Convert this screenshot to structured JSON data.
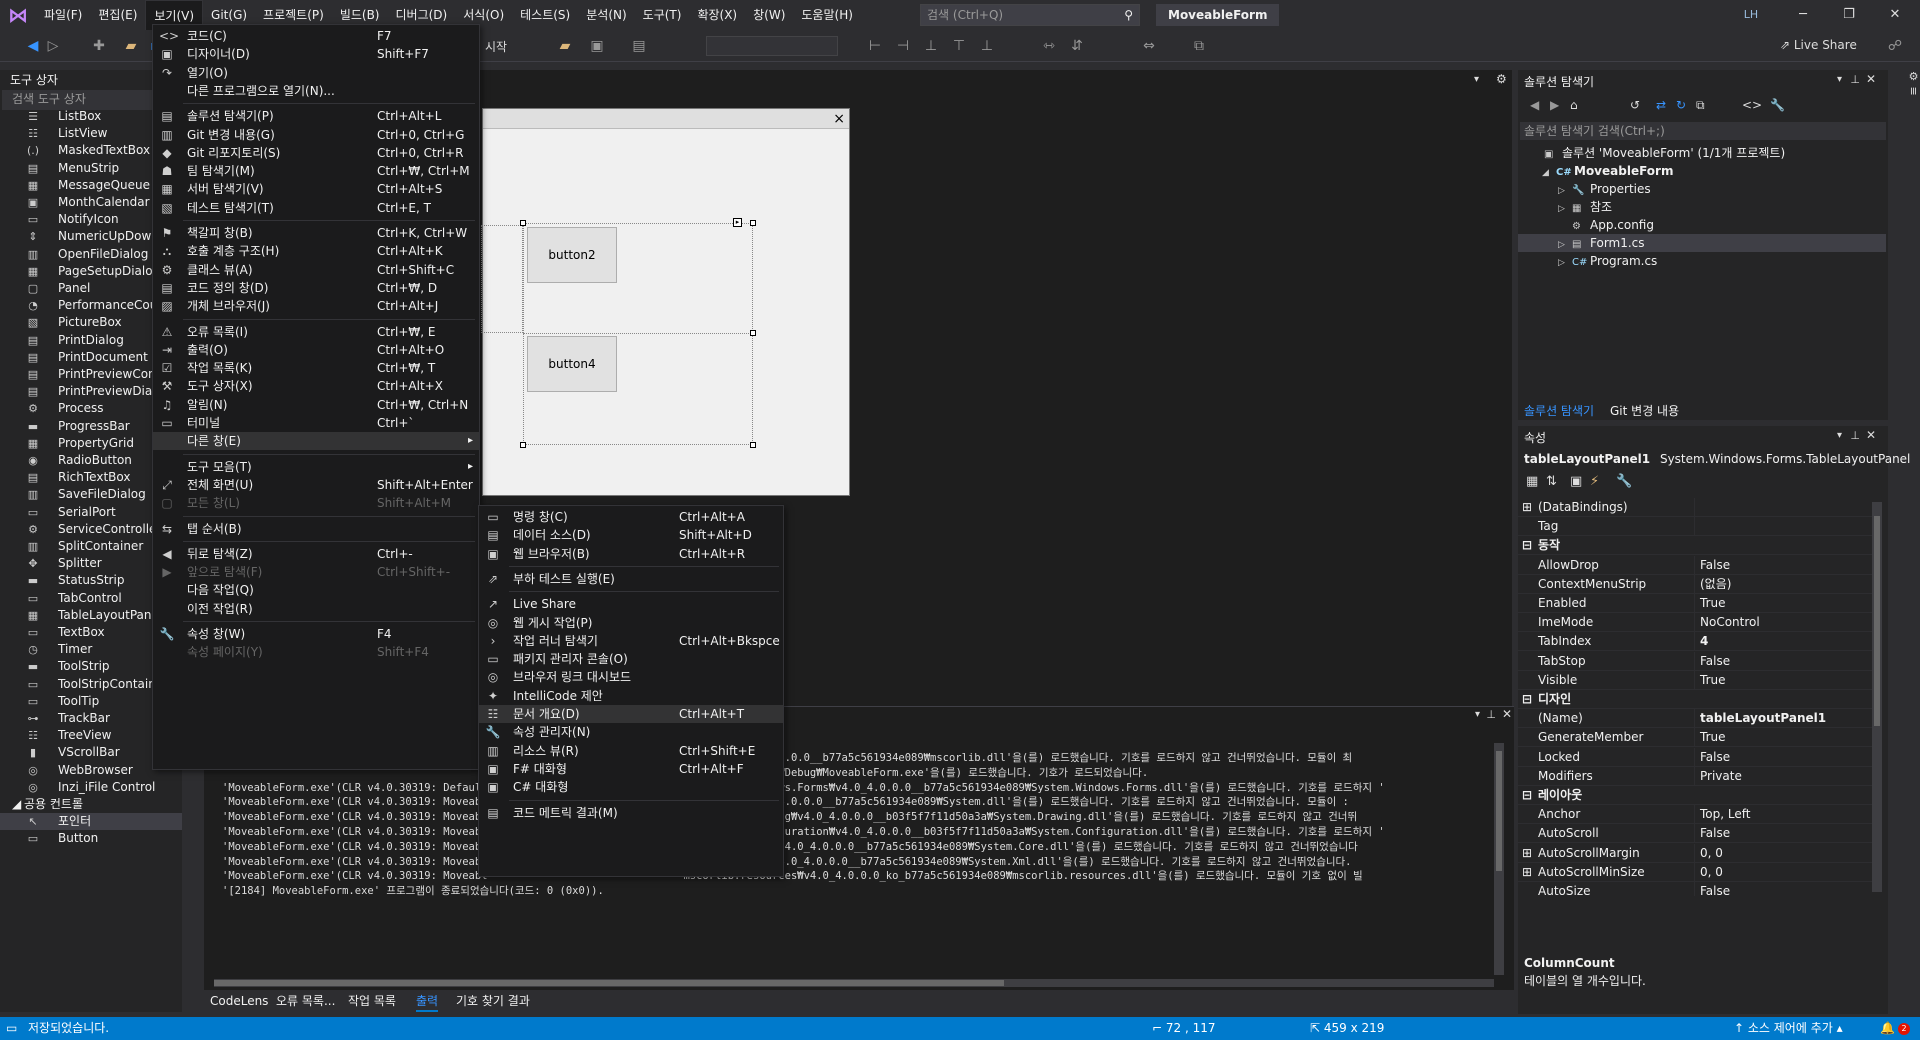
{
  "menubar": {
    "items": [
      "파일(F)",
      "편집(E)",
      "보기(V)",
      "Git(G)",
      "프로젝트(P)",
      "빌드(B)",
      "디버그(D)",
      "서식(O)",
      "테스트(S)",
      "분석(N)",
      "도구(T)",
      "확장(X)",
      "창(W)",
      "도움말(H)"
    ],
    "search_placeholder": "검색 (Ctrl+Q)",
    "app_title": "MoveableForm",
    "avatar": "LH"
  },
  "toolbar": {
    "start_label": "시작",
    "live_share": "Live Share"
  },
  "toolbox": {
    "title": "도구 상자",
    "search_placeholder": "검색 도구 상자",
    "items": [
      "ListBox",
      "ListView",
      "MaskedTextBox",
      "MenuStrip",
      "MessageQueue",
      "MonthCalendar",
      "NotifyIcon",
      "NumericUpDown",
      "OpenFileDialog",
      "PageSetupDialog",
      "Panel",
      "PerformanceCou",
      "PictureBox",
      "PrintDialog",
      "PrintDocument",
      "PrintPreviewCont",
      "PrintPreviewDial",
      "Process",
      "ProgressBar",
      "PropertyGrid",
      "RadioButton",
      "RichTextBox",
      "SaveFileDialog",
      "SerialPort",
      "ServiceController",
      "SplitContainer",
      "Splitter",
      "StatusStrip",
      "TabControl",
      "TableLayoutPanel",
      "TextBox",
      "Timer",
      "ToolStrip",
      "ToolStripContainer",
      "ToolTip",
      "TrackBar",
      "TreeView",
      "VScrollBar",
      "WebBrowser",
      "Inzi_iFile Control"
    ],
    "group": "공용 컨트롤",
    "group_items": [
      "포인터",
      "Button"
    ]
  },
  "designer": {
    "buttons": [
      "button2",
      "button4"
    ],
    "close": "×"
  },
  "view_menu": [
    {
      "label": "코드(C)",
      "key": "F7",
      "icon": "<>"
    },
    {
      "label": "디자이너(D)",
      "key": "Shift+F7",
      "icon": "▣"
    },
    {
      "label": "열기(O)",
      "key": "",
      "icon": "↷"
    },
    {
      "label": "다른 프로그램으로 열기(N)...",
      "key": "",
      "icon": ""
    },
    {
      "sep": true
    },
    {
      "label": "솔루션 탐색기(P)",
      "key": "Ctrl+Alt+L",
      "icon": "▤"
    },
    {
      "label": "Git 변경 내용(G)",
      "key": "Ctrl+0, Ctrl+G",
      "icon": "▥"
    },
    {
      "label": "Git 리포지토리(S)",
      "key": "Ctrl+0, Ctrl+R",
      "icon": "◆"
    },
    {
      "label": "팀 탐색기(M)",
      "key": "Ctrl+₩, Ctrl+M",
      "icon": "☗"
    },
    {
      "label": "서버 탐색기(V)",
      "key": "Ctrl+Alt+S",
      "icon": "▦"
    },
    {
      "label": "테스트 탐색기(T)",
      "key": "Ctrl+E, T",
      "icon": "▧"
    },
    {
      "sep": true
    },
    {
      "label": "책갈피 창(B)",
      "key": "Ctrl+K, Ctrl+W",
      "icon": "⚑"
    },
    {
      "label": "호출 계층 구조(H)",
      "key": "Ctrl+Alt+K",
      "icon": "⛬"
    },
    {
      "label": "클래스 뷰(A)",
      "key": "Ctrl+Shift+C",
      "icon": "⚙"
    },
    {
      "label": "코드 정의 창(D)",
      "key": "Ctrl+₩, D",
      "icon": "▤"
    },
    {
      "label": "개체 브라우저(J)",
      "key": "Ctrl+Alt+J",
      "icon": "▨"
    },
    {
      "sep": true
    },
    {
      "label": "오류 목록(I)",
      "key": "Ctrl+₩, E",
      "icon": "⚠"
    },
    {
      "label": "출력(O)",
      "key": "Ctrl+Alt+O",
      "icon": "⇥"
    },
    {
      "label": "작업 목록(K)",
      "key": "Ctrl+₩, T",
      "icon": "☑"
    },
    {
      "label": "도구 상자(X)",
      "key": "Ctrl+Alt+X",
      "icon": "⚒"
    },
    {
      "label": "알림(N)",
      "key": "Ctrl+₩, Ctrl+N",
      "icon": "♫"
    },
    {
      "label": "터미널",
      "key": "Ctrl+`",
      "icon": "▭"
    },
    {
      "label": "다른 창(E)",
      "key": "",
      "icon": "",
      "sub": true,
      "hl": true
    },
    {
      "sep": true
    },
    {
      "label": "도구 모음(T)",
      "key": "",
      "icon": "",
      "sub": true
    },
    {
      "label": "전체 화면(U)",
      "key": "Shift+Alt+Enter",
      "icon": "⤢"
    },
    {
      "label": "모든 창(L)",
      "key": "Shift+Alt+M",
      "icon": "▢",
      "dis": true
    },
    {
      "sep": true
    },
    {
      "label": "탭 순서(B)",
      "key": "",
      "icon": "⇆"
    },
    {
      "sep": true
    },
    {
      "label": "뒤로 탐색(Z)",
      "key": "Ctrl+-",
      "icon": "◀"
    },
    {
      "label": "앞으로 탐색(F)",
      "key": "Ctrl+Shift+-",
      "icon": "▶",
      "dis": true
    },
    {
      "label": "다음 작업(Q)",
      "key": "",
      "icon": ""
    },
    {
      "label": "이전 작업(R)",
      "key": "",
      "icon": ""
    },
    {
      "sep": true
    },
    {
      "label": "속성 창(W)",
      "key": "F4",
      "icon": "🔧"
    },
    {
      "label": "속성 페이지(Y)",
      "key": "Shift+F4",
      "icon": "",
      "dis": true
    }
  ],
  "other_windows_menu": [
    {
      "label": "명령 창(C)",
      "key": "Ctrl+Alt+A",
      "icon": "▭"
    },
    {
      "label": "데이터 소스(D)",
      "key": "Shift+Alt+D",
      "icon": "▤"
    },
    {
      "label": "웹 브라우저(B)",
      "key": "Ctrl+Alt+R",
      "icon": "▣"
    },
    {
      "sep": true
    },
    {
      "label": "부하 테스트 실행(E)",
      "key": "",
      "icon": "⇗"
    },
    {
      "sep": true
    },
    {
      "label": "Live Share",
      "key": "",
      "icon": "↗"
    },
    {
      "label": "웹 게시 작업(P)",
      "key": "",
      "icon": "◎"
    },
    {
      "label": "작업 러너 탐색기",
      "key": "Ctrl+Alt+Bkspce",
      "icon": "›"
    },
    {
      "label": "패키지 관리자 콘솔(O)",
      "key": "",
      "icon": "▭"
    },
    {
      "label": "브라우저 링크 대시보드",
      "key": "",
      "icon": "◎"
    },
    {
      "label": "IntelliCode 제안",
      "key": "",
      "icon": "✦"
    },
    {
      "label": "문서 개요(D)",
      "key": "Ctrl+Alt+T",
      "icon": "☷",
      "hl": true
    },
    {
      "label": "속성 관리자(N)",
      "key": "",
      "icon": "🔧"
    },
    {
      "label": "리소스 뷰(R)",
      "key": "Ctrl+Shift+E",
      "icon": "▥"
    },
    {
      "label": "F# 대화형",
      "key": "Ctrl+Alt+F",
      "icon": "▣"
    },
    {
      "label": "C# 대화형",
      "key": "",
      "icon": "▣"
    },
    {
      "sep": true
    },
    {
      "label": "코드 메트릭 결과(M)",
      "key": "",
      "icon": "▤"
    }
  ],
  "output": {
    "lines": [
      "                                                                         scorlib₩v4.0_4.0.0.0__b77a5c561934e089₩mscorlib.dll'을(를) 로드했습니다. 기호를 로드하지 않고 건너뛰었습니다. 모듈이 최",
      "                                                                         oveableForm₩bin₩Debug₩MoveableForm.exe'을(를) 로드했습니다. 기호가 로드되었습니다.",
      "'MoveableForm.exe'(CLR v4.0.30319: DefaultD                              IL₩System.Windows.Forms₩v4.0_4.0.0.0__b77a5c561934e089₩System.Windows.Forms.dll'을(를) 로드했습니다. 기호를 로드하지 '",
      "'MoveableForm.exe'(CLR v4.0.30319: Moveabl                               IL₩System₩v4.0_4.0.0.0__b77a5c561934e089₩System.dll'을(를) 로드했습니다. 기호를 로드하지 않고 건너뛰었습니다. 모듈이 :",
      "'MoveableForm.exe'(CLR v4.0.30319: Moveabl                               IL₩System.Drawing₩v4.0_4.0.0.0__b03f5f7f11d50a3a₩System.Drawing.dll'을(를) 로드했습니다. 기호를 로드하지 않고 건너뛰",
      "'MoveableForm.exe'(CLR v4.0.30319: Moveabl                               IL₩System.Configuration₩v4.0_4.0.0.0__b03f5f7f11d50a3a₩System.Configuration.dll'을(를) 로드했습니다. 기호를 로드하지 '",
      "'MoveableForm.exe'(CLR v4.0.30319: Moveabl                               IL₩System.Core₩v4.0_4.0.0.0__b77a5c561934e089₩System.Core.dll'을(를) 로드했습니다. 기호를 로드하지 않고 건너뛰었습니다",
      "'MoveableForm.exe'(CLR v4.0.30319: Moveabl                               IL₩System.Xml₩v4.0_4.0.0.0__b77a5c561934e089₩System.Xml.dll'을(를) 로드했습니다. 기호를 로드하지 않고 건너뛰었습니다.",
      "'MoveableForm.exe'(CLR v4.0.30319: Moveabl                               mscorlib.resources₩v4.0_4.0.0.0_ko_b77a5c561934e089₩mscorlib.resources.dll'을(를) 로드했습니다. 모듈이 기호 없이 빌",
      "'[2184] MoveableForm.exe' 프로그램이 종료되었습니다(코드: 0 (0x0))."
    ],
    "tabs": [
      "CodeLens",
      "오류 목록...",
      "작업 목록",
      "출력",
      "기호 찾기 결과"
    ],
    "active_tab": "출력"
  },
  "solution": {
    "title": "솔루션 탐색기",
    "search_placeholder": "솔루션 탐색기 검색(Ctrl+;)",
    "nodes": [
      "솔루션 'MoveableForm' (1/1개 프로젝트)",
      "MoveableForm",
      "Properties",
      "참조",
      "App.config",
      "Form1.cs",
      "Program.cs"
    ],
    "tabs": [
      "솔루션 탐색기",
      "Git 변경 내용"
    ]
  },
  "properties": {
    "title": "속성",
    "object": "tableLayoutPanel1",
    "type": "System.Windows.Forms.TableLayoutPanel",
    "rows": [
      {
        "n": "(DataBindings)",
        "v": "",
        "exp": "+"
      },
      {
        "n": "Tag",
        "v": ""
      },
      {
        "n": "동작",
        "v": "",
        "cat": true
      },
      {
        "n": "AllowDrop",
        "v": "False"
      },
      {
        "n": "ContextMenuStrip",
        "v": "(없음)"
      },
      {
        "n": "Enabled",
        "v": "True"
      },
      {
        "n": "ImeMode",
        "v": "NoControl"
      },
      {
        "n": "TabIndex",
        "v": "4",
        "b": true
      },
      {
        "n": "TabStop",
        "v": "False"
      },
      {
        "n": "Visible",
        "v": "True"
      },
      {
        "n": "디자인",
        "v": "",
        "cat": true
      },
      {
        "n": "(Name)",
        "v": "tableLayoutPanel1",
        "b": true
      },
      {
        "n": "GenerateMember",
        "v": "True"
      },
      {
        "n": "Locked",
        "v": "False"
      },
      {
        "n": "Modifiers",
        "v": "Private"
      },
      {
        "n": "레이아웃",
        "v": "",
        "cat": true
      },
      {
        "n": "Anchor",
        "v": "Top, Left"
      },
      {
        "n": "AutoScroll",
        "v": "False"
      },
      {
        "n": "AutoScrollMargin",
        "v": "0, 0",
        "exp": "+"
      },
      {
        "n": "AutoScrollMinSize",
        "v": "0, 0",
        "exp": "+"
      },
      {
        "n": "AutoSize",
        "v": "False"
      },
      {
        "n": "AutoSizeMode",
        "v": "GrowOnly"
      },
      {
        "n": "ColumnCount",
        "v": "2",
        "b": true
      },
      {
        "n": "Columns",
        "v": "(컬렉션)"
      }
    ],
    "desc_title": "ColumnCount",
    "desc": "테이블의 열 개수입니다."
  },
  "statusbar": {
    "left": "저장되었습니다.",
    "pos": "72 , 117",
    "size": "459 x 219",
    "source": "소스 제어에 추가",
    "notif": "2"
  }
}
